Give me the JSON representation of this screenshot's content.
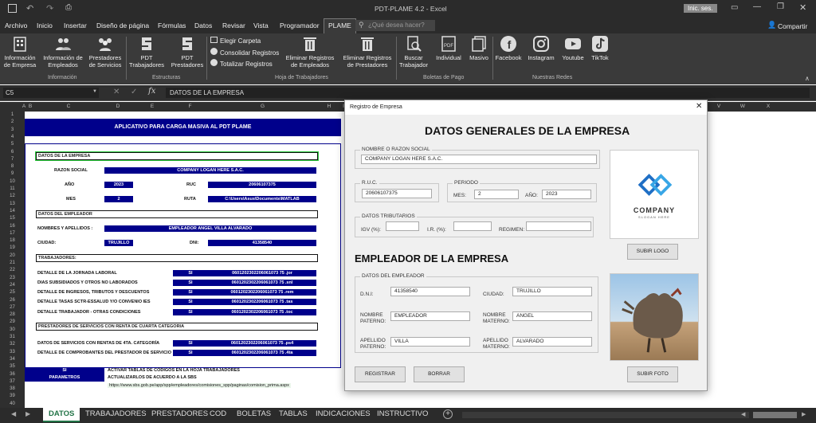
{
  "titlebar": {
    "title": "PDT-PLAME 4.2  -  Excel",
    "signin": "Inic. ses."
  },
  "menu": {
    "items": [
      "Archivo",
      "Inicio",
      "Insertar",
      "Diseño de página",
      "Fórmulas",
      "Datos",
      "Revisar",
      "Vista",
      "Programador",
      "PLAME"
    ],
    "search_placeholder": "¿Qué desea hacer?",
    "share": "Compartir"
  },
  "ribbon": {
    "informacion": {
      "empresa": "Información de Empresa",
      "empleados": "Información de Empleados",
      "prestadores": "Prestadores de Servicios",
      "group": "Información"
    },
    "estructuras": {
      "pdt_trab": "PDT Trabajadores",
      "pdt_prest": "PDT Prestadores",
      "group": "Estructuras"
    },
    "hoja": {
      "elegir": "Elegir Carpeta",
      "consolidar": "Consolidar Registros",
      "totalizar": "Totalizar Registros",
      "elim_emp": "Eliminar Registros de Empleados",
      "elim_prest": "Eliminar Registros de Prestadores",
      "group": "Hoja de Trabajadores"
    },
    "boletas": {
      "buscar": "Buscar Trabajador",
      "individual": "Individual",
      "masivo": "Masivo",
      "group": "Boletas de Pago"
    },
    "redes": {
      "facebook": "Facebook",
      "instagram": "Instagram",
      "youtube": "Youtube",
      "tiktok": "TikTok",
      "group": "Nuestras Redes"
    }
  },
  "formula_bar": {
    "cell": "C5",
    "value": "DATOS DE LA EMPRESA"
  },
  "columns": [
    "A",
    "B",
    "C",
    "D",
    "E",
    "F",
    "G",
    "H",
    "I",
    "J",
    "K",
    "L",
    "M",
    "N",
    "O",
    "P",
    "Q",
    "R",
    "S",
    "T",
    "U",
    "V",
    "W",
    "X"
  ],
  "rows": [
    "1",
    "2",
    "3",
    "4",
    "5",
    "6",
    "7",
    "8",
    "9",
    "10",
    "11",
    "12",
    "13",
    "14",
    "15",
    "16",
    "17",
    "18",
    "19",
    "20",
    "21",
    "22",
    "23",
    "24",
    "25",
    "26",
    "27",
    "28",
    "29",
    "30",
    "31",
    "32",
    "33",
    "34",
    "35",
    "36",
    "37",
    "38",
    "39",
    "40"
  ],
  "sheet": {
    "banner": "APLICATIVO PARA CARGA MASIVA AL PDT PLAME",
    "datos_empresa": "DATOS DE LA EMPRESA",
    "razon_label": "RAZON SOCIAL",
    "razon_value": "COMPANY LOGAN HERE S.A.C.",
    "anio_label": "AÑO",
    "anio_value": "2023",
    "ruc_label": "RUC",
    "ruc_value": "20606107375",
    "mes_label": "MES",
    "mes_value": "2",
    "ruta_label": "RUTA",
    "ruta_value": "C:\\Users\\Asus\\Documents\\MATLAB",
    "datos_empleador": "DATOS DEL EMPLEADOR",
    "nombres_label": "NOMBRES Y APELLIDOS :",
    "nombres_value": "EMPLEADOR ANGEL VILLA ALVARADO",
    "ciudad_label": "CIUDAD:",
    "ciudad_value": "TRUJILLO",
    "dni_label": "DNI:",
    "dni_value": "41358540",
    "trabajadores": "TRABAJADORES:",
    "trab_rows": [
      {
        "label": "DETALLE DE LA JORNADA LABORAL",
        "flag": "SI",
        "file": "0601202302206061073 75 .jor"
      },
      {
        "label": "DIAS SUBSIDIADOS Y OTROS NO LABORADOS",
        "flag": "SI",
        "file": "0601202302206061073 75 .snl"
      },
      {
        "label": "DETALLE DE INGRESOS, TRIBUTOS Y DESCUENTOS",
        "flag": "SI",
        "file": "0601202302206061073 75 .rem"
      },
      {
        "label": "DETALLE TASAS SCTR-ESSALUD Y/O CONVENIO IES",
        "flag": "SI",
        "file": "0601202302206061073 75 .tas"
      },
      {
        "label": "DETALLE TRABAJADOR - OTRAS CONDICIONES",
        "flag": "SI",
        "file": "0601202302206061073 75 .toc"
      }
    ],
    "prestadores": "PRESTADORES DE SERVICIOS CON RENTA DE CUARTA CATEGORIA",
    "prest_rows": [
      {
        "label": "DATOS DE SERVICIOS CON RENTAS DE 4TA. CATEGORÍA",
        "flag": "SI",
        "file": "0601202302206061073 75 .ps4"
      },
      {
        "label": "DETALLE DE COMPROBANTES DEL PRESTADOR DE SERVICIO",
        "flag": "SI",
        "file": "0601202302206061073 75 .4ta"
      }
    ],
    "foot_si": "SI",
    "foot_param": "PARAMETROS",
    "foot_line1": "ACTIVAR TABLAS DE CÓDIGOS EN LA HOJA TRABAJADORES",
    "foot_line2": "ACTUALIZARLOS DE ACUERDO A LA SBS",
    "foot_link": "https://www.sbs.gob.pe/app/spp/empleadores/comisiones_spp/paginas/comision_prima.aspx"
  },
  "dialog": {
    "title": "Registro de Empresa",
    "heading": "DATOS GENERALES DE LA EMPRESA",
    "razon_legend": "NOMBRE O RAZON SOCIAL",
    "razon_value": "COMPANY LOGAN HERE S.A.C.",
    "ruc_legend": "R.U.C.",
    "ruc_value": "20606107375",
    "periodo_legend": "PERIODO",
    "mes_label": "MES:",
    "mes_value": "2",
    "anio_label": "AÑO:",
    "anio_value": "2023",
    "trib_legend": "DATOS TRIBUTARIOS",
    "igv_label": "IGV (%):",
    "ir_label": "I.R. (%):",
    "regimen_label": "REGIMEN:",
    "logo_word": "COMPANY",
    "logo_tag": "SLOGAN HERE",
    "subir_logo": "SUBIR LOGO",
    "empleador_heading": "EMPLEADOR DE LA EMPRESA",
    "empleado_legend": "DATOS DEL EMPLEADOR",
    "dni_label": "D.N.I:",
    "dni_value": "41358540",
    "ciudad_label": "CIUDAD:",
    "ciudad_value": "TRUJILLO",
    "nombre_label": "NOMBRE PATERNO:",
    "nombre_value": "EMPLEADOR",
    "nombre_mat_label": "NOMBRE MATERNO:",
    "nombre_mat_value": "ANGEL",
    "ape_pat_label": "APELLIDO PATERNO:",
    "ape_pat_value": "VILLA",
    "ape_mat_label": "APELLIDO MATERNO:",
    "ape_mat_value": "ALVARADO",
    "registrar": "REGISTRAR",
    "borrar": "BORRAR",
    "subir_foto": "SUBIR FOTO"
  },
  "sheet_tabs": [
    "DATOS",
    "TRABAJADORES",
    "PRESTADORES",
    "COD",
    "BOLETAS",
    "TABLAS",
    "INDICACIONES",
    "INSTRUCTIVO"
  ],
  "colors": {
    "accent": "#00008b",
    "excel_green": "#217346"
  }
}
